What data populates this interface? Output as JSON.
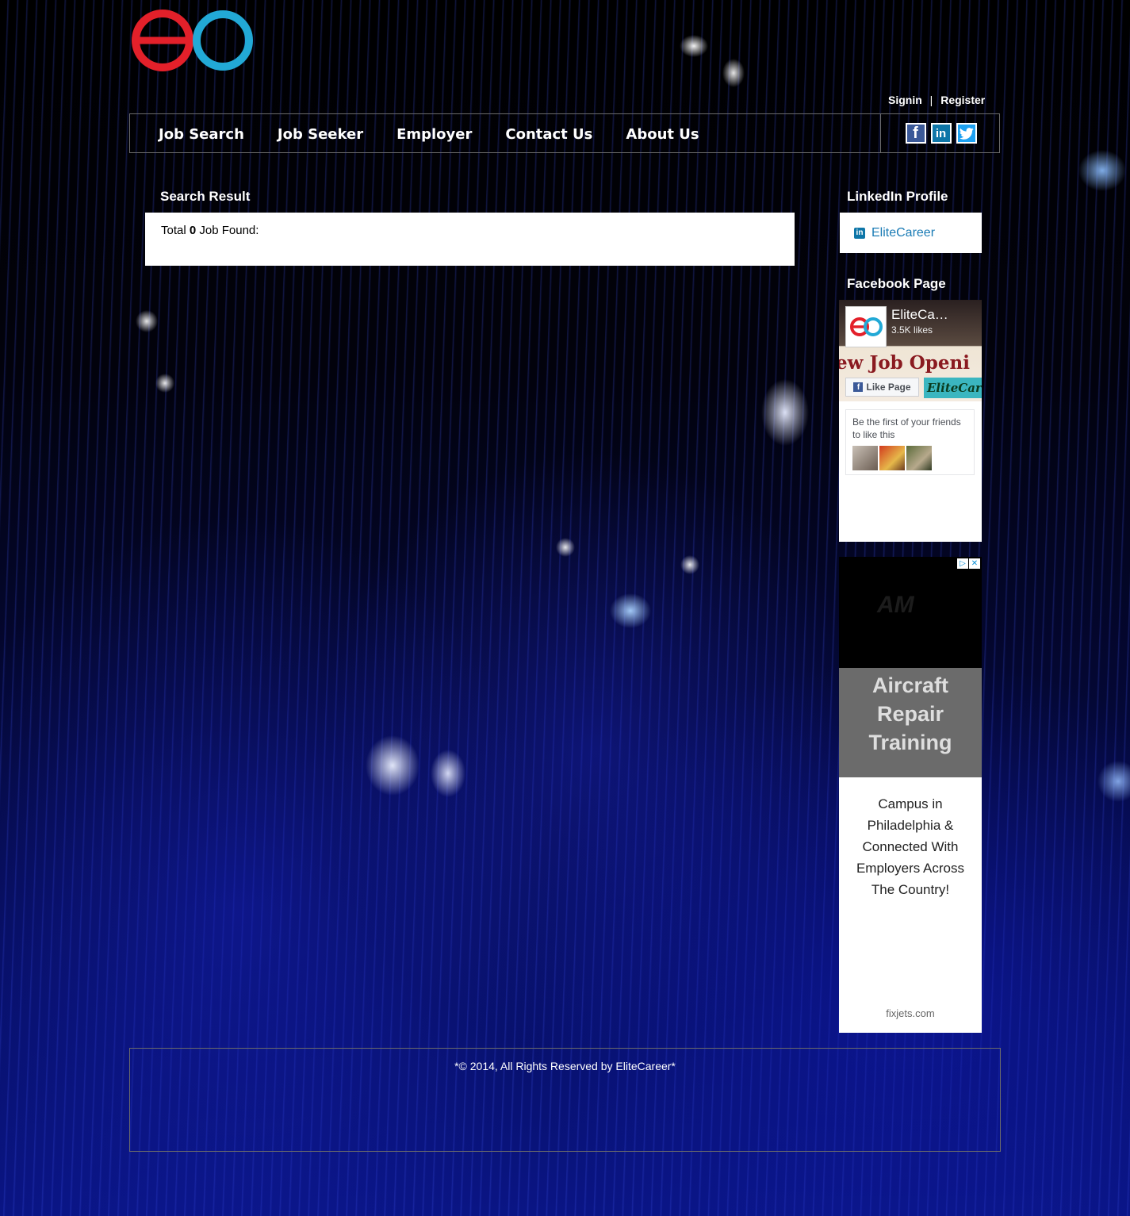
{
  "header": {
    "logo_name": "eo-ring-logo",
    "signin_label": "Signin",
    "separator": "|",
    "register_label": "Register"
  },
  "nav": {
    "items": [
      {
        "label": "Job Search"
      },
      {
        "label": "Job Seeker"
      },
      {
        "label": "Employer"
      },
      {
        "label": "Contact Us"
      },
      {
        "label": "About Us"
      }
    ],
    "social": {
      "facebook_icon": "facebook-icon",
      "linkedin_icon": "linkedin-icon",
      "twitter_icon": "twitter-icon"
    }
  },
  "search_result": {
    "title": "Search Result",
    "total_prefix": "Total",
    "count": "0",
    "total_suffix": "Job Found:"
  },
  "linkedin": {
    "title": "LinkedIn Profile",
    "link_label": "EliteCareer"
  },
  "facebook": {
    "title": "Facebook Page",
    "page_name": "EliteCa…",
    "likes": "3.5K likes",
    "cover_headline": "ew Job Openi",
    "like_button": "Like Page",
    "brand_tag": "EliteCar",
    "friends_text": "Be the first of your friends to like this"
  },
  "ad": {
    "logo_text": "AM",
    "headline": [
      "Aircraft",
      "Repair",
      "Training"
    ],
    "body": "Campus in Philadelphia & Connected With Employers Across The Country!",
    "domain": "fixjets.com",
    "adchoices": "▷",
    "close": "✕"
  },
  "footer": {
    "text": "*© 2014, All Rights Reserved by EliteCareer*"
  },
  "colors": {
    "logo_red": "#e3202a",
    "logo_blue": "#22a9d6",
    "page_bg": "#000000",
    "link_blue": "#1a7bb5"
  }
}
